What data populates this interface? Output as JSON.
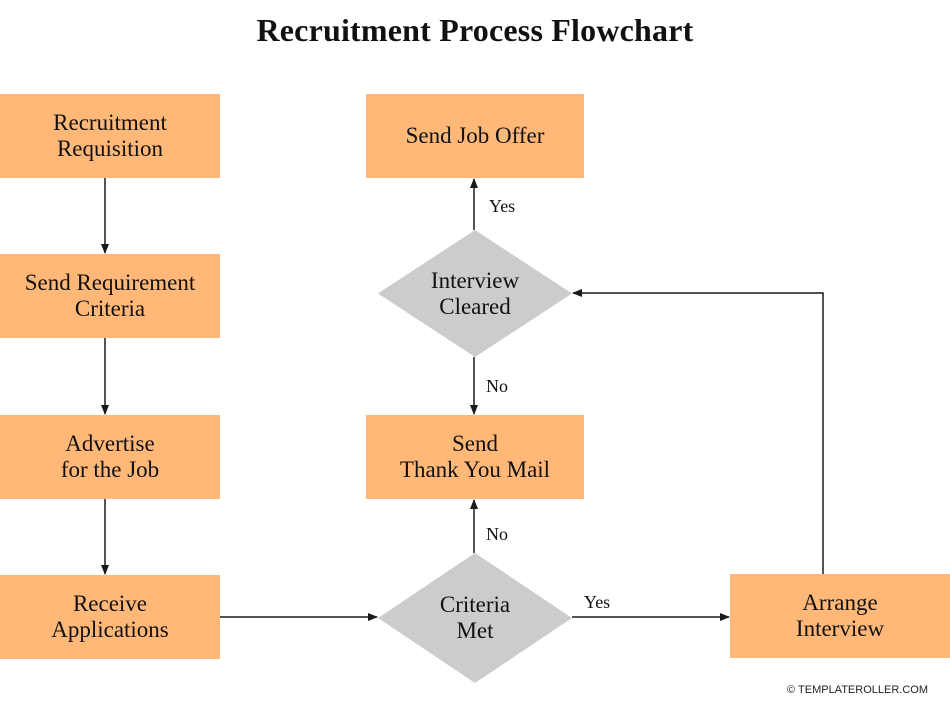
{
  "title": "Recruitment Process Flowchart",
  "colors": {
    "process": "#FFB877",
    "decision": "#CCCCCC",
    "line": "#1a1a1a"
  },
  "nodes": {
    "recruitment_requisition": {
      "type": "process",
      "lines": [
        "Recruitment",
        "Requisition"
      ]
    },
    "send_requirement_criteria": {
      "type": "process",
      "lines": [
        "Send Requirement",
        "Criteria"
      ]
    },
    "advertise_job": {
      "type": "process",
      "lines": [
        "Advertise",
        "for the Job"
      ]
    },
    "receive_applications": {
      "type": "process",
      "lines": [
        "Receive",
        "Applications"
      ]
    },
    "criteria_met": {
      "type": "decision",
      "lines": [
        "Criteria",
        "Met"
      ]
    },
    "arrange_interview": {
      "type": "process",
      "lines": [
        "Arrange",
        "Interview"
      ]
    },
    "interview_cleared": {
      "type": "decision",
      "lines": [
        "Interview",
        "Cleared"
      ]
    },
    "send_job_offer": {
      "type": "process",
      "lines": [
        "Send Job Offer"
      ]
    },
    "send_thank_you_mail": {
      "type": "process",
      "lines": [
        "Send",
        "Thank You Mail"
      ]
    }
  },
  "edges": [
    {
      "from": "recruitment_requisition",
      "to": "send_requirement_criteria",
      "label": ""
    },
    {
      "from": "send_requirement_criteria",
      "to": "advertise_job",
      "label": ""
    },
    {
      "from": "advertise_job",
      "to": "receive_applications",
      "label": ""
    },
    {
      "from": "receive_applications",
      "to": "criteria_met",
      "label": ""
    },
    {
      "from": "criteria_met",
      "to": "arrange_interview",
      "label": "Yes"
    },
    {
      "from": "criteria_met",
      "to": "send_thank_you_mail",
      "label": "No"
    },
    {
      "from": "arrange_interview",
      "to": "interview_cleared",
      "label": ""
    },
    {
      "from": "interview_cleared",
      "to": "send_job_offer",
      "label": "Yes"
    },
    {
      "from": "interview_cleared",
      "to": "send_thank_you_mail",
      "label": "No"
    }
  ],
  "labels": {
    "yes": "Yes",
    "no": "No"
  },
  "footer": "© TEMPLATEROLLER.COM"
}
